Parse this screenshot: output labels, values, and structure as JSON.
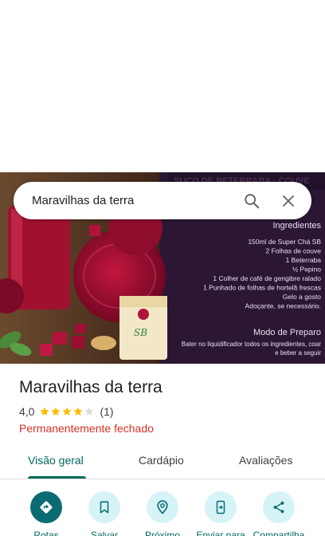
{
  "search": {
    "query": "Maravilhas da terra"
  },
  "photo": {
    "banner_text": "SUCO DE BETERRABA · COUVE",
    "heading": "Ingredientes",
    "ingredients": [
      "150ml de Super Chá SB",
      "2 Folhas de couve",
      "1 Beterraba",
      "½ Pepino",
      "1 Colher de café de gengibre ralado",
      "1 Punhado de folhas de hortelã frescas",
      "Gelo a gosto",
      "Adoçante, se necessário."
    ],
    "prep_heading": "Modo de Preparo",
    "prep_lines": [
      "Bater no liquidificador todos os ingredientes, coar",
      "e beber a seguir"
    ],
    "package_label": "SB"
  },
  "place": {
    "name": "Maravilhas da terra",
    "rating_text": "4,0",
    "rating": 4.0,
    "rating_max": 5,
    "review_count": "(1)",
    "status": "Permanentemente fechado"
  },
  "tabs": [
    {
      "label": "Visão geral",
      "active": true
    },
    {
      "label": "Cardápio",
      "active": false
    },
    {
      "label": "Avaliações",
      "active": false
    }
  ],
  "actions": [
    {
      "label": "Rotas",
      "icon": "directions-icon",
      "primary": true
    },
    {
      "label": "Salvar",
      "icon": "bookmark-icon"
    },
    {
      "label": "Próximo",
      "icon": "nearby-icon"
    },
    {
      "label": "Enviar para",
      "icon": "send-to-phone-icon"
    },
    {
      "label": "Compartilha",
      "icon": "share-icon"
    }
  ],
  "colors": {
    "accent": "#00695c",
    "status_closed": "#d93025",
    "star": "#fbbc04",
    "action_bg": "#d6f3f8",
    "primary_action_bg": "#0b6b73"
  }
}
